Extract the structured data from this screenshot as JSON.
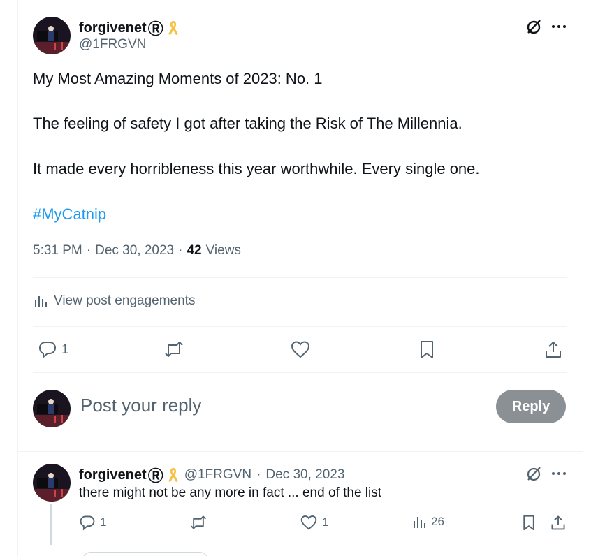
{
  "tweet": {
    "author_name": "forgivenet",
    "registered_mark": "Ⓡ",
    "handle": "@1FRGVN",
    "lines": [
      "My Most Amazing Moments of 2023: No. 1",
      "The feeling of safety I got after taking the Risk of The Millennia.",
      "It made every horribleness this year worthwhile. Every single one."
    ],
    "hashtag": "#MyCatnip",
    "time": "5:31 PM",
    "dot": "·",
    "date": "Dec 30, 2023",
    "views_count": "42",
    "views_label": "Views",
    "engagements_label": "View post engagements",
    "reply_count": "1"
  },
  "composer": {
    "placeholder": "Post your reply",
    "reply_button": "Reply"
  },
  "reply": {
    "author_name": "forgivenet",
    "registered_mark": "Ⓡ",
    "handle": "@1FRGVN",
    "dot": "·",
    "date": "Dec 30, 2023",
    "text": "there might not be any more in fact ... end of the list",
    "reply_count": "1",
    "like_count": "1",
    "views_count": "26"
  },
  "colors": {
    "accent": "#1d9bf0",
    "muted": "#536471",
    "ribbon": "#f6c244"
  }
}
